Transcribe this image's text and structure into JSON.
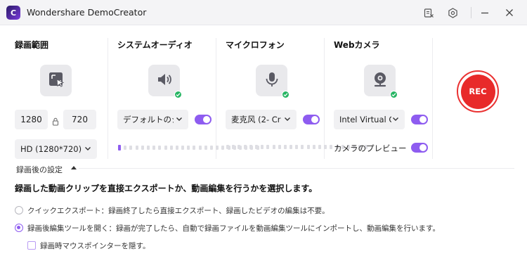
{
  "window": {
    "title": "Wondershare DemoCreator",
    "logo_letter": "C"
  },
  "colors": {
    "accent": "#8e5cf0",
    "rec_red": "#e82a2a",
    "ok_green": "#26b563"
  },
  "icons": [
    "app-logo-icon",
    "export-log-icon",
    "settings-icon",
    "minimize-icon",
    "close-icon",
    "screen-region-icon",
    "speaker-icon",
    "microphone-icon",
    "webcam-icon",
    "check-icon",
    "chevron-down-icon",
    "chevron-up-icon"
  ],
  "screen": {
    "title": "録画範囲",
    "width": "1280",
    "height": "720",
    "preset": "HD (1280*720)"
  },
  "system_audio": {
    "title": "システムオーディオ",
    "device": "デフォルトのシステム",
    "enabled": true,
    "level": 0.05
  },
  "microphone": {
    "title": "マイクロフォン",
    "device": "麦克风 (2- Cr",
    "enabled": true,
    "level": 0
  },
  "webcam": {
    "title": "Webカメラ",
    "device": "Intel Virtual C",
    "enabled": true,
    "preview_label": "カメラのプレビュー",
    "preview_enabled": true
  },
  "rec_button": {
    "label": "REC"
  },
  "after_recording": {
    "header": "録画後の設定",
    "description": "録画した動画クリップを直接エクスポートか、動画編集を行うかを選択します。",
    "options": [
      {
        "label": "クイックエクスポート：録画終了したら直接エクスポート、録画したビデオの編集は不要。",
        "selected": false
      },
      {
        "label": "録画後編集ツールを開く：録画が完了したら、自動で録画ファイルを動画編集ツールにインポートし、動画編集を行います。",
        "selected": true
      }
    ],
    "hide_pointer_label": "録画時マウスポインターを隠す。",
    "hide_pointer_checked": false
  }
}
